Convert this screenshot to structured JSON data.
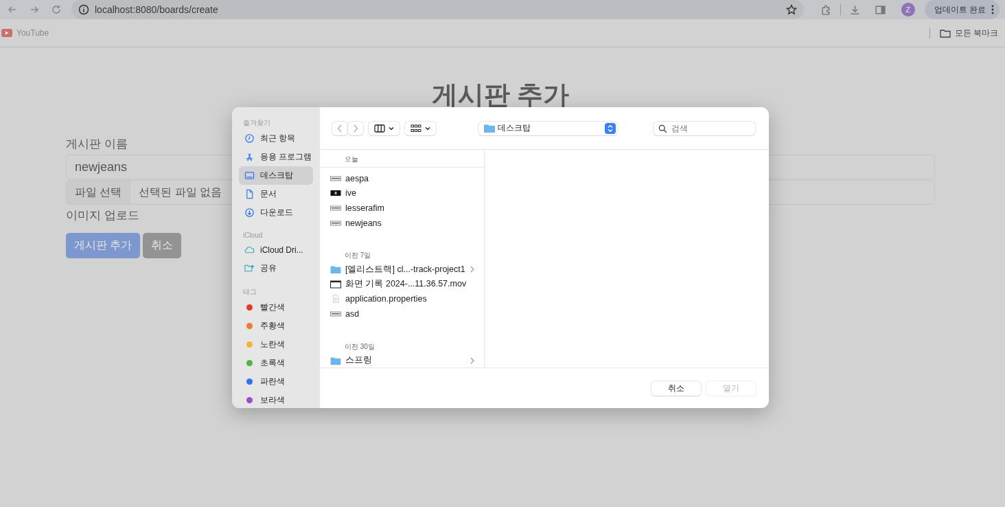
{
  "browser": {
    "url": "localhost:8080/boards/create",
    "profile_initial": "Z",
    "update_button": "업데이트 완료",
    "bookmarks": [
      {
        "label": "YouTube"
      }
    ],
    "all_bookmarks": "모든 북마크"
  },
  "page": {
    "title": "게시판 추가",
    "name_label": "게시판 이름",
    "name_value": "newjeans",
    "file_button": "파일 선택",
    "file_status": "선택된 파일 없음",
    "image_label": "이미지 업로드",
    "submit_button": "게시판 추가",
    "cancel_button": "취소"
  },
  "dialog": {
    "sidebar": [
      {
        "heading": "즐겨찾기",
        "items": [
          {
            "label": "최근 항목",
            "kind": "clock",
            "selected": false
          },
          {
            "label": "응용 프로그램",
            "kind": "apps",
            "selected": false
          },
          {
            "label": "데스크탑",
            "kind": "desktop",
            "selected": true
          },
          {
            "label": "문서",
            "kind": "document",
            "selected": false
          },
          {
            "label": "다운로드",
            "kind": "download",
            "selected": false
          }
        ]
      },
      {
        "heading": "iCloud",
        "items": [
          {
            "label": "iCloud Dri...",
            "kind": "cloud",
            "selected": false
          },
          {
            "label": "공유",
            "kind": "shared",
            "selected": false
          }
        ]
      },
      {
        "heading": "태그",
        "items": [
          {
            "label": "빨간색",
            "kind": "tag",
            "color": "#e8382e",
            "selected": false
          },
          {
            "label": "주황색",
            "kind": "tag",
            "color": "#ee7b2c",
            "selected": false
          },
          {
            "label": "노란색",
            "kind": "tag",
            "color": "#f0b632",
            "selected": false
          },
          {
            "label": "초록색",
            "kind": "tag",
            "color": "#4cb83c",
            "selected": false
          },
          {
            "label": "파란색",
            "kind": "tag",
            "color": "#2f72f0",
            "selected": false
          },
          {
            "label": "보라색",
            "kind": "tag",
            "color": "#9a4fc8",
            "selected": false
          }
        ]
      }
    ],
    "location": "데스크탑",
    "search_placeholder": "검색",
    "groups": [
      {
        "heading": "오늘",
        "files": [
          {
            "name": "aespa",
            "kind": "image"
          },
          {
            "name": "ive",
            "kind": "dark-image"
          },
          {
            "name": "lesserafim",
            "kind": "image"
          },
          {
            "name": "newjeans",
            "kind": "image"
          }
        ]
      },
      {
        "heading": "이전 7일",
        "files": [
          {
            "name": "[엘리스트랙] cl...-track-project1",
            "kind": "folder"
          },
          {
            "name": "화면 기록 2024-...11.36.57.mov",
            "kind": "video"
          },
          {
            "name": "application.properties",
            "kind": "text"
          },
          {
            "name": "asd",
            "kind": "image"
          }
        ]
      },
      {
        "heading": "이전 30일",
        "files": [
          {
            "name": "스프링",
            "kind": "folder"
          }
        ]
      }
    ],
    "cancel_button": "취소",
    "open_button": {
      "label": "열기",
      "disabled": true
    }
  }
}
